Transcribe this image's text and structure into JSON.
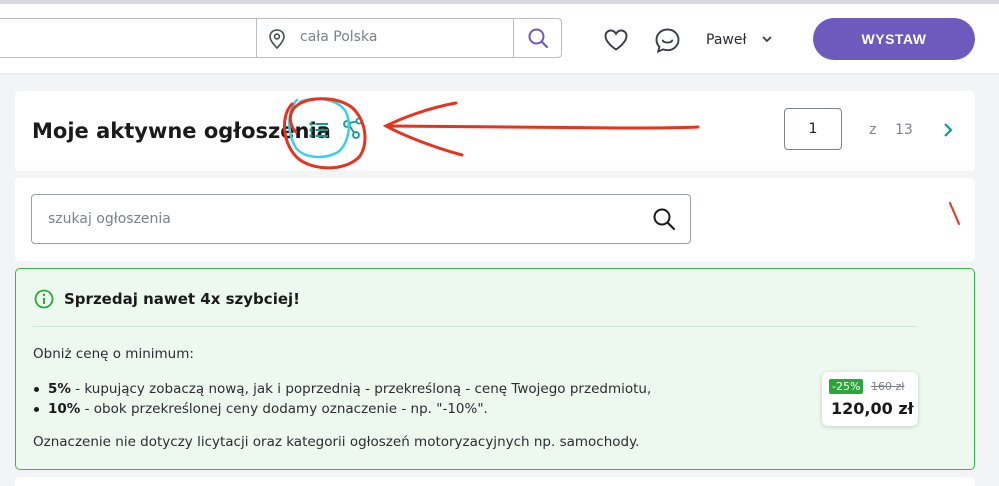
{
  "header": {
    "location_placeholder": "cała Polska",
    "user_name": "Paweł",
    "post_button": "WYSTAW"
  },
  "listing_header": {
    "title": "Moje aktywne ogłoszenia",
    "current_page": "1",
    "of_label": "z",
    "total_pages": "13"
  },
  "ad_search": {
    "placeholder": "szukaj ogłoszenia"
  },
  "promo": {
    "title": "Sprzedaj nawet 4x szybciej!",
    "intro": "Obniż cenę o minimum:",
    "bullets": [
      {
        "bold": "5%",
        "text": " - kupujący zobaczą nową, jak i poprzednią - przekreśloną - cenę Twojego przedmiotu,"
      },
      {
        "bold": "10%",
        "text": " - obok przekreślonej ceny dodamy oznaczenie - np. \"-10%\"."
      }
    ],
    "note": "Oznaczenie nie dotyczy licytacji oraz kategorii ogłoszeń motoryzacyjnych np. samochody.",
    "example": {
      "discount": "-25%",
      "old_price": "160 zł",
      "new_price": "120,00 zł"
    }
  },
  "colors": {
    "accent": "#6c5bbd",
    "teal": "#0f9d8f",
    "success": "#3bb54a",
    "annotation_red": "#e8321e",
    "annotation_cyan": "#39d0e6"
  }
}
